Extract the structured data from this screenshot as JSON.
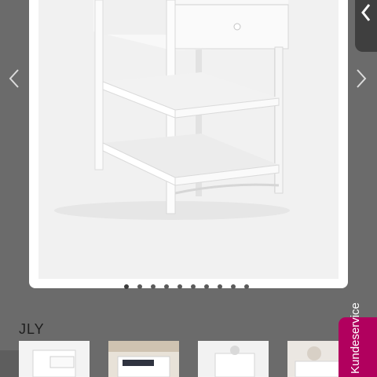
{
  "gallery": {
    "image_count": 10,
    "active_index": 0,
    "prev_icon": "chevron-left-icon",
    "next_icon": "chevron-right-icon",
    "close_icon": "chevron-left-icon"
  },
  "product": {
    "brand_label": "JLY"
  },
  "thumbnails": [
    {
      "name": "thumbnail-1"
    },
    {
      "name": "thumbnail-2"
    },
    {
      "name": "thumbnail-3"
    },
    {
      "name": "thumbnail-4"
    }
  ],
  "support": {
    "label": "Kundeservice"
  },
  "colors": {
    "overlay": "#6b6b6b",
    "accent": "#b1005e"
  }
}
